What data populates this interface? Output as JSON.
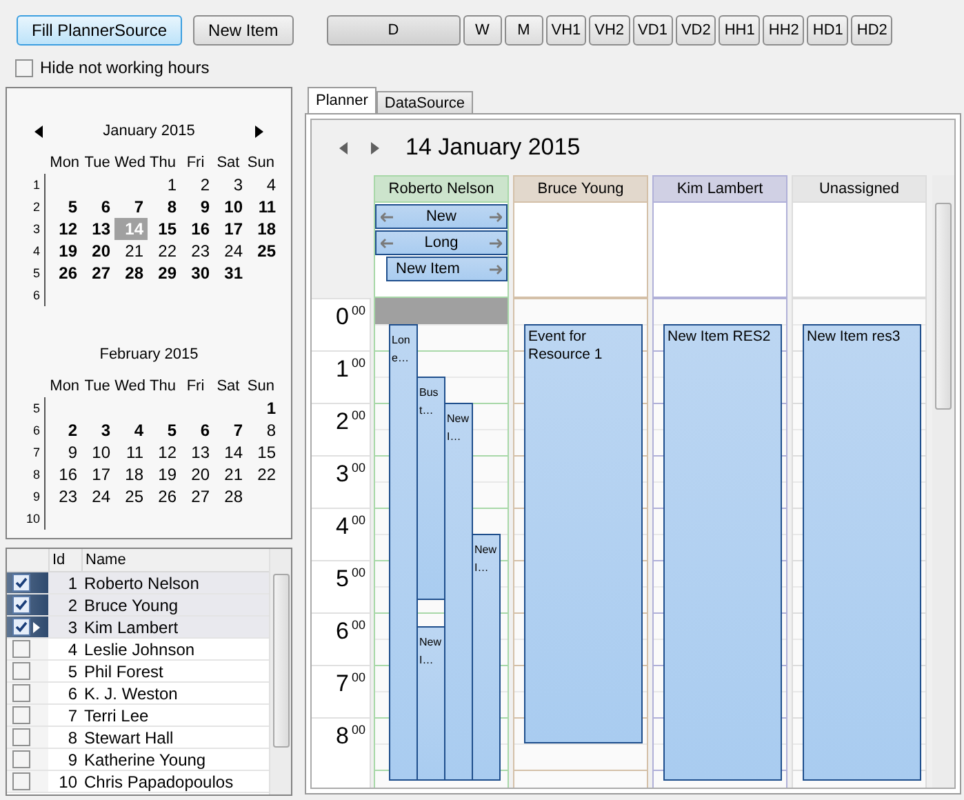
{
  "toolbar": {
    "actions": [
      {
        "label": "Fill PlannerSource",
        "focused": true
      },
      {
        "label": "New Item",
        "focused": false
      }
    ],
    "views": [
      {
        "label": "D",
        "selected": true
      },
      {
        "label": "W",
        "selected": false
      },
      {
        "label": "M",
        "selected": false
      },
      {
        "label": "VH1",
        "selected": false
      },
      {
        "label": "VH2",
        "selected": false
      },
      {
        "label": "VD1",
        "selected": false
      },
      {
        "label": "VD2",
        "selected": false
      },
      {
        "label": "HH1",
        "selected": false
      },
      {
        "label": "HH2",
        "selected": false
      },
      {
        "label": "HD1",
        "selected": false
      },
      {
        "label": "HD2",
        "selected": false
      }
    ]
  },
  "hide_hours": {
    "label": "Hide not working hours",
    "checked": false
  },
  "calendar": {
    "months": [
      {
        "title": "January 2015",
        "weekdays": [
          "Mon",
          "Tue",
          "Wed",
          "Thu",
          "Fri",
          "Sat",
          "Sun"
        ],
        "weeks": [
          {
            "week": "1",
            "days": [
              {
                "day": "1",
                "bold": false,
                "selected": false
              },
              {
                "day": "2",
                "bold": false,
                "selected": false
              },
              {
                "day": "3",
                "bold": false,
                "selected": false
              },
              {
                "day": "4",
                "bold": false,
                "selected": false
              }
            ]
          },
          {
            "week": "2",
            "days": [
              {
                "day": "5",
                "bold": true,
                "selected": false
              },
              {
                "day": "6",
                "bold": true,
                "selected": false
              },
              {
                "day": "7",
                "bold": true,
                "selected": false
              },
              {
                "day": "8",
                "bold": true,
                "selected": false
              },
              {
                "day": "9",
                "bold": true,
                "selected": false
              },
              {
                "day": "10",
                "bold": true,
                "selected": false
              },
              {
                "day": "11",
                "bold": true,
                "selected": false
              }
            ]
          },
          {
            "week": "3",
            "days": [
              {
                "day": "12",
                "bold": true,
                "selected": false
              },
              {
                "day": "13",
                "bold": true,
                "selected": false
              },
              {
                "day": "14",
                "bold": true,
                "selected": true
              },
              {
                "day": "15",
                "bold": true,
                "selected": false
              },
              {
                "day": "16",
                "bold": true,
                "selected": false
              },
              {
                "day": "17",
                "bold": true,
                "selected": false
              },
              {
                "day": "18",
                "bold": true,
                "selected": false
              }
            ]
          },
          {
            "week": "4",
            "days": [
              {
                "day": "19",
                "bold": true,
                "selected": false
              },
              {
                "day": "20",
                "bold": true,
                "selected": false
              },
              {
                "day": "21",
                "bold": false,
                "selected": false
              },
              {
                "day": "22",
                "bold": false,
                "selected": false
              },
              {
                "day": "23",
                "bold": false,
                "selected": false
              },
              {
                "day": "24",
                "bold": false,
                "selected": false
              },
              {
                "day": "25",
                "bold": true,
                "selected": false
              }
            ]
          },
          {
            "week": "5",
            "days": [
              {
                "day": "26",
                "bold": true,
                "selected": false
              },
              {
                "day": "27",
                "bold": true,
                "selected": false
              },
              {
                "day": "28",
                "bold": true,
                "selected": false
              },
              {
                "day": "29",
                "bold": true,
                "selected": false
              },
              {
                "day": "30",
                "bold": true,
                "selected": false
              },
              {
                "day": "31",
                "bold": true,
                "selected": false
              }
            ]
          },
          {
            "week": "6"
          }
        ]
      },
      {
        "title": "February 2015",
        "weekdays": [
          "Mon",
          "Tue",
          "Wed",
          "Thu",
          "Fri",
          "Sat",
          "Sun"
        ],
        "weeks": [
          {
            "week": "5",
            "days": [
              {
                "day": "1",
                "bold": true,
                "selected": false
              }
            ]
          },
          {
            "week": "6",
            "days": [
              {
                "day": "2",
                "bold": true,
                "selected": false
              },
              {
                "day": "3",
                "bold": true,
                "selected": false
              },
              {
                "day": "4",
                "bold": true,
                "selected": false
              },
              {
                "day": "5",
                "bold": true,
                "selected": false
              },
              {
                "day": "6",
                "bold": true,
                "selected": false
              },
              {
                "day": "7",
                "bold": true,
                "selected": false
              },
              {
                "day": "8",
                "bold": false,
                "selected": false
              }
            ]
          },
          {
            "week": "7",
            "days": [
              {
                "day": "9",
                "bold": false,
                "selected": false
              },
              {
                "day": "10",
                "bold": false,
                "selected": false
              },
              {
                "day": "11",
                "bold": false,
                "selected": false
              },
              {
                "day": "12",
                "bold": false,
                "selected": false
              },
              {
                "day": "13",
                "bold": false,
                "selected": false
              },
              {
                "day": "14",
                "bold": false,
                "selected": false
              },
              {
                "day": "15",
                "bold": false,
                "selected": false
              }
            ]
          },
          {
            "week": "8",
            "days": [
              {
                "day": "16",
                "bold": false,
                "selected": false
              },
              {
                "day": "17",
                "bold": false,
                "selected": false
              },
              {
                "day": "18",
                "bold": false,
                "selected": false
              },
              {
                "day": "19",
                "bold": false,
                "selected": false
              },
              {
                "day": "20",
                "bold": false,
                "selected": false
              },
              {
                "day": "21",
                "bold": false,
                "selected": false
              },
              {
                "day": "22",
                "bold": false,
                "selected": false
              }
            ]
          },
          {
            "week": "9",
            "days": [
              {
                "day": "23",
                "bold": false,
                "selected": false
              },
              {
                "day": "24",
                "bold": false,
                "selected": false
              },
              {
                "day": "25",
                "bold": false,
                "selected": false
              },
              {
                "day": "26",
                "bold": false,
                "selected": false
              },
              {
                "day": "27",
                "bold": false,
                "selected": false
              },
              {
                "day": "28",
                "bold": false,
                "selected": false
              }
            ]
          },
          {
            "week": "10"
          }
        ]
      }
    ]
  },
  "resources_grid": {
    "columns": [
      "Id",
      "Name"
    ],
    "rows": [
      {
        "id": "1",
        "name": "Roberto Nelson",
        "checked": true,
        "selected": true,
        "current": false
      },
      {
        "id": "2",
        "name": "Bruce Young",
        "checked": true,
        "selected": true,
        "current": false
      },
      {
        "id": "3",
        "name": "Kim Lambert",
        "checked": true,
        "selected": true,
        "current": true
      },
      {
        "id": "4",
        "name": "Leslie Johnson",
        "checked": false,
        "selected": false,
        "current": false
      },
      {
        "id": "5",
        "name": "Phil Forest",
        "checked": false,
        "selected": false,
        "current": false
      },
      {
        "id": "6",
        "name": "K. J. Weston",
        "checked": false,
        "selected": false,
        "current": false
      },
      {
        "id": "7",
        "name": "Terri Lee",
        "checked": false,
        "selected": false,
        "current": false
      },
      {
        "id": "8",
        "name": "Stewart Hall",
        "checked": false,
        "selected": false,
        "current": false
      },
      {
        "id": "9",
        "name": "Katherine Young",
        "checked": false,
        "selected": false,
        "current": false
      },
      {
        "id": "10",
        "name": "Chris Papadopoulos",
        "checked": false,
        "selected": false,
        "current": false
      }
    ]
  },
  "tabs": [
    {
      "label": "Planner",
      "selected": true
    },
    {
      "label": "DataSource",
      "selected": false
    }
  ],
  "planner": {
    "date": "14 January 2015",
    "hours": [
      {
        "hour": "0",
        "minutes": "00"
      },
      {
        "hour": "1",
        "minutes": "00"
      },
      {
        "hour": "2",
        "minutes": "00"
      },
      {
        "hour": "3",
        "minutes": "00"
      },
      {
        "hour": "4",
        "minutes": "00"
      },
      {
        "hour": "5",
        "minutes": "00"
      },
      {
        "hour": "6",
        "minutes": "00"
      },
      {
        "hour": "7",
        "minutes": "00"
      },
      {
        "hour": "8",
        "minutes": "00"
      }
    ],
    "resources": [
      {
        "name": "Roberto Nelson",
        "color": "#a8d8a8",
        "slot_selected": true,
        "all_day": [
          {
            "title": "New",
            "continues_before": true,
            "continues_after": true
          },
          {
            "title": "Long",
            "continues_before": true,
            "continues_after": true
          },
          {
            "title": "New Item",
            "continues_before": false,
            "continues_after": true
          }
        ],
        "events": [
          {
            "lines": [
              "Lon",
              "e…"
            ]
          },
          {
            "lines": [
              "Bus",
              "t…"
            ]
          },
          {
            "lines": [
              "New",
              "I…"
            ]
          },
          {
            "lines": [
              "New",
              "I…"
            ]
          },
          {
            "lines": [
              "New",
              "I…"
            ]
          }
        ]
      },
      {
        "name": "Bruce Young",
        "color": "#d4c0a8",
        "slot_selected": false,
        "events": [
          {
            "lines": [
              "Event for",
              "Resource 1"
            ]
          }
        ]
      },
      {
        "name": "Kim Lambert",
        "color": "#b0b0d8",
        "slot_selected": false,
        "events": [
          {
            "lines": [
              "New Item RES2"
            ]
          }
        ]
      },
      {
        "name": "Unassigned",
        "color": "#dcdcdc",
        "slot_selected": false,
        "events": [
          {
            "lines": [
              "New Item res3"
            ]
          }
        ]
      }
    ]
  }
}
